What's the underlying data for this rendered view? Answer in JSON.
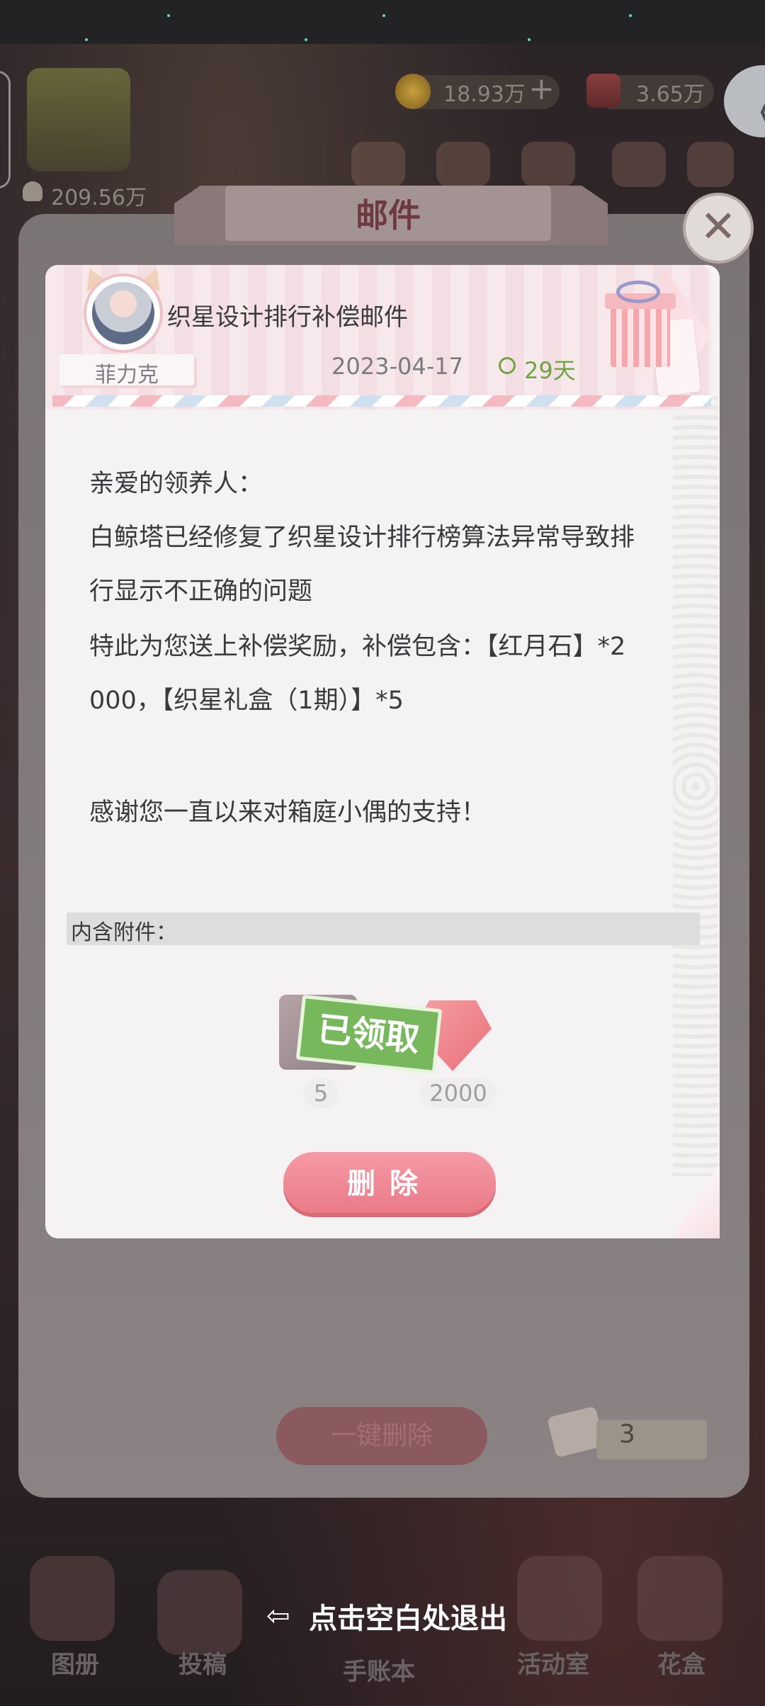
{
  "hud": {
    "fans_count": "209.56万",
    "coins": "18.93万",
    "coin_plus": "+",
    "gems": "3.65万",
    "back_symbol": "《"
  },
  "window": {
    "title": "邮件",
    "close_symbol": "✕",
    "one_key_delete_label": "一键删除",
    "mail_count": "3"
  },
  "mail": {
    "sender": "菲力克",
    "subject": "织星设计排行补偿邮件",
    "date": "2023-04-17",
    "expires": "29天",
    "body_lines": [
      "亲爱的领养人：",
      "白鲸塔已经修复了织星设计排行榜算法异常导致排",
      "行显示不正确的问题",
      "特此为您送上补偿奖励，补偿包含：【红月石】*2",
      "000，【织星礼盒（1期）】*5",
      "",
      "感谢您一直以来对箱庭小偶的支持！"
    ],
    "attachments_label": "内含附件：",
    "attachments": [
      {
        "count": "5",
        "icon": "gift-box-icon"
      },
      {
        "count": "2000",
        "icon": "red-moonstone-icon"
      }
    ],
    "claimed_label": "已领取",
    "delete_label": "删除"
  },
  "bottom_nav": [
    "图册",
    "投稿",
    "手账本",
    "活动室",
    "花盒"
  ],
  "exit_hint": "点击空白处退出",
  "colors": {
    "accent_pink": "#ea7a88",
    "claimed_green": "#78b85c",
    "expire_green": "#6ea542"
  }
}
